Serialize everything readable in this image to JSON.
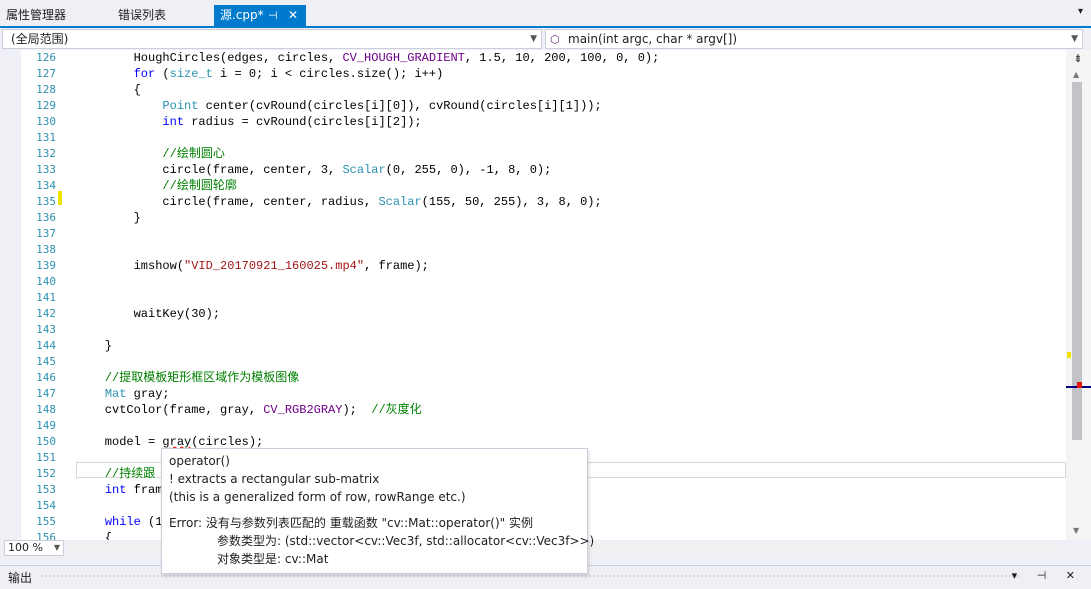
{
  "tabs": {
    "properties_label": "属性管理器",
    "errors_label": "错误列表",
    "source_label": "源.cpp*",
    "source_pin": "⊣",
    "source_close": "✕",
    "overflow": "▾"
  },
  "navbar": {
    "scope": "(全局范围)",
    "function": "main(int argc, char * argv[])"
  },
  "editor": {
    "line_numbers": [
      "126",
      "127",
      "128",
      "129",
      "130",
      "131",
      "132",
      "133",
      "134",
      "135",
      "136",
      "137",
      "138",
      "139",
      "140",
      "141",
      "142",
      "143",
      "144",
      "145",
      "146",
      "147",
      "148",
      "149",
      "150",
      "151",
      "152",
      "153",
      "154",
      "155",
      "156"
    ],
    "code_lines": [
      [
        [
          "        HoughCircles(edges, circles, ",
          ""
        ],
        [
          "CV_HOUGH_GRADIENT",
          "mc"
        ],
        [
          ", 1.5, 10, 200, 100, 0, 0);",
          ""
        ]
      ],
      [
        [
          "        ",
          ""
        ],
        [
          "for",
          "kw"
        ],
        [
          " (",
          ""
        ],
        [
          "size_t",
          "ty"
        ],
        [
          " i = 0; i < circles.size(); i++)",
          ""
        ]
      ],
      [
        [
          "        {",
          ""
        ]
      ],
      [
        [
          "            ",
          ""
        ],
        [
          "Point",
          "ty"
        ],
        [
          " center(cvRound(circles[i][0]), cvRound(circles[i][1]));",
          ""
        ]
      ],
      [
        [
          "            ",
          ""
        ],
        [
          "int",
          "kw"
        ],
        [
          " radius = cvRound(circles[i][2]);",
          ""
        ]
      ],
      [
        [
          "",
          ""
        ]
      ],
      [
        [
          "            ",
          ""
        ],
        [
          "//绘制圆心",
          "cm"
        ]
      ],
      [
        [
          "            circle(frame, center, 3, ",
          ""
        ],
        [
          "Scalar",
          "ty"
        ],
        [
          "(0, 255, 0), -1, 8, 0);",
          ""
        ]
      ],
      [
        [
          "            ",
          ""
        ],
        [
          "//绘制圆轮廓",
          "cm"
        ]
      ],
      [
        [
          "            circle(frame, center, radius, ",
          ""
        ],
        [
          "Scalar",
          "ty"
        ],
        [
          "(155, 50, 255), 3, 8, 0);",
          ""
        ]
      ],
      [
        [
          "        }",
          ""
        ]
      ],
      [
        [
          "",
          ""
        ]
      ],
      [
        [
          "",
          ""
        ]
      ],
      [
        [
          "        imshow(",
          ""
        ],
        [
          "\"VID_20170921_160025.mp4\"",
          "st"
        ],
        [
          ", frame);",
          ""
        ]
      ],
      [
        [
          "",
          ""
        ]
      ],
      [
        [
          "",
          ""
        ]
      ],
      [
        [
          "        waitKey(30);",
          ""
        ]
      ],
      [
        [
          "",
          ""
        ]
      ],
      [
        [
          "    }",
          ""
        ]
      ],
      [
        [
          "",
          ""
        ]
      ],
      [
        [
          "    ",
          ""
        ],
        [
          "//提取模板矩形框区域作为模板图像",
          "cm"
        ]
      ],
      [
        [
          "    ",
          ""
        ],
        [
          "Mat",
          "ty"
        ],
        [
          " gray;",
          ""
        ]
      ],
      [
        [
          "    cvtColor(frame, gray, ",
          ""
        ],
        [
          "CV_RGB2GRAY",
          "mc"
        ],
        [
          ");  ",
          ""
        ],
        [
          "//灰度化",
          "cm"
        ]
      ],
      [
        [
          "",
          ""
        ]
      ],
      [
        [
          "    model = ",
          ""
        ],
        [
          "gray",
          "sq"
        ],
        [
          "(circles);",
          ""
        ]
      ],
      [
        [
          "",
          ""
        ]
      ],
      [
        [
          "    ",
          ""
        ],
        [
          "//持续跟",
          "cm"
        ]
      ],
      [
        [
          "    ",
          ""
        ],
        [
          "int",
          "kw"
        ],
        [
          " fram",
          ""
        ]
      ],
      [
        [
          "",
          ""
        ]
      ],
      [
        [
          "    ",
          ""
        ],
        [
          "while",
          "kw"
        ],
        [
          " (1",
          ""
        ]
      ],
      [
        [
          "    {",
          ""
        ]
      ]
    ]
  },
  "zoom": "100 %",
  "output": {
    "title": "输出",
    "controls": "▾ ⊣ ✕"
  },
  "tooltip": {
    "line1": "operator()",
    "line2": "! extracts a rectangular sub-matrix",
    "line3": "(this is a generalized form of row, rowRange etc.)",
    "line4": "Error: 没有与参数列表匹配的 重载函数 \"cv::Mat::operator()\" 实例",
    "line5": "参数类型为:  (std::vector<cv::Vec3f, std::allocator<cv::Vec3f>>)",
    "line6": "对象类型是:  cv::Mat"
  },
  "colors": {
    "accent": "#007acc",
    "keyword": "#0000ff",
    "type": "#2b91af",
    "macro": "#6f008a",
    "comment": "#008000",
    "string": "#a31515",
    "error_squiggle": "#e51400",
    "change_marker": "#efe300"
  }
}
